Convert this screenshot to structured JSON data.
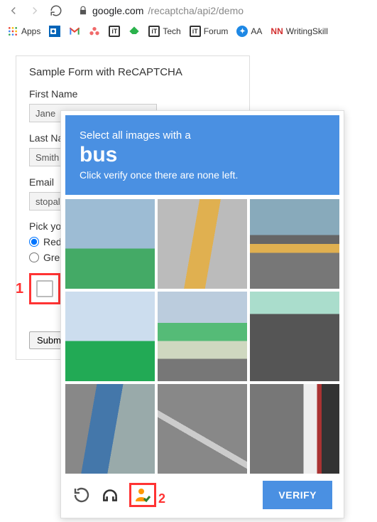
{
  "browser": {
    "url_host": "google.com",
    "url_path": "/recaptcha/api2/demo"
  },
  "bookmarks": {
    "apps": "Apps",
    "tech": "Tech",
    "forum": "Forum",
    "aa": "AA",
    "writingskill": "WritingSkill",
    "nn": "NN",
    "it": "iT"
  },
  "form": {
    "title": "Sample Form with ReCAPTCHA",
    "first_name_label": "First Name",
    "first_name_value": "Jane",
    "last_name_label": "Last Name",
    "last_name_value": "Smith",
    "email_label": "Email",
    "email_value": "stopallbots@gmail.com",
    "pick_label": "Pick your favorite color:",
    "color_red": "Red",
    "color_green": "Green",
    "submit": "Submit"
  },
  "captcha": {
    "instruction_pre": "Select all images with a",
    "subject": "bus",
    "instruction_post": "Click verify once there are none left.",
    "verify": "VERIFY"
  },
  "annotations": {
    "one": "1",
    "two": "2"
  }
}
